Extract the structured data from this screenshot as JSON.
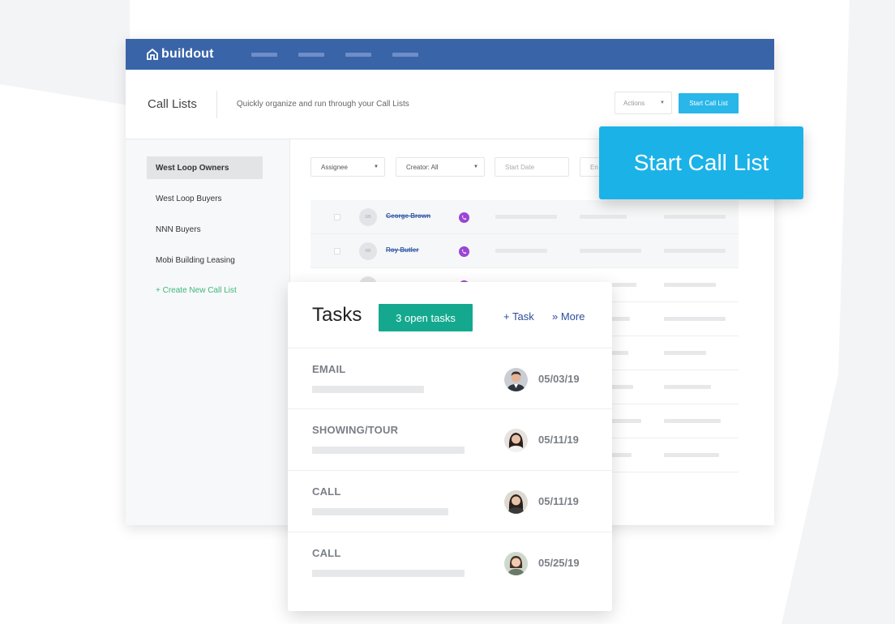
{
  "brand": {
    "name": "buildout",
    "nav_color": "#3a64a8",
    "accent": "#29b6e8"
  },
  "header": {
    "title": "Call Lists",
    "subtitle": "Quickly organize and run through your Call Lists",
    "actions_label": "Actions",
    "start_label": "Start Call List"
  },
  "sidebar": {
    "items": [
      {
        "label": "West Loop Owners",
        "active": true
      },
      {
        "label": "West Loop Buyers",
        "active": false
      },
      {
        "label": "NNN Buyers",
        "active": false
      },
      {
        "label": "Mobi Building Leasing",
        "active": false
      }
    ],
    "create_label": "+ Create New Call List"
  },
  "filters": {
    "assignee": "Assignee",
    "creator": "Creator: All",
    "start_date": "Start Date",
    "end_date": "En"
  },
  "table": {
    "rows": [
      {
        "initials": "GB",
        "name": "George Brown"
      },
      {
        "initials": "RB",
        "name": "Roy Butler"
      }
    ]
  },
  "popup": {
    "label": "Start Call List",
    "color": "#1bb2e8"
  },
  "tasks": {
    "title": "Tasks",
    "badge": "3 open tasks",
    "add_label": "+ Task",
    "more_label": "» More",
    "items": [
      {
        "type": "EMAIL",
        "date": "05/03/19",
        "avatar": "man-avatar"
      },
      {
        "type": "SHOWING/TOUR",
        "date": "05/11/19",
        "avatar": "woman-avatar"
      },
      {
        "type": "CALL",
        "date": "05/11/19",
        "avatar": "woman-avatar"
      },
      {
        "type": "CALL",
        "date": "05/25/19",
        "avatar": "woman-avatar"
      }
    ]
  }
}
